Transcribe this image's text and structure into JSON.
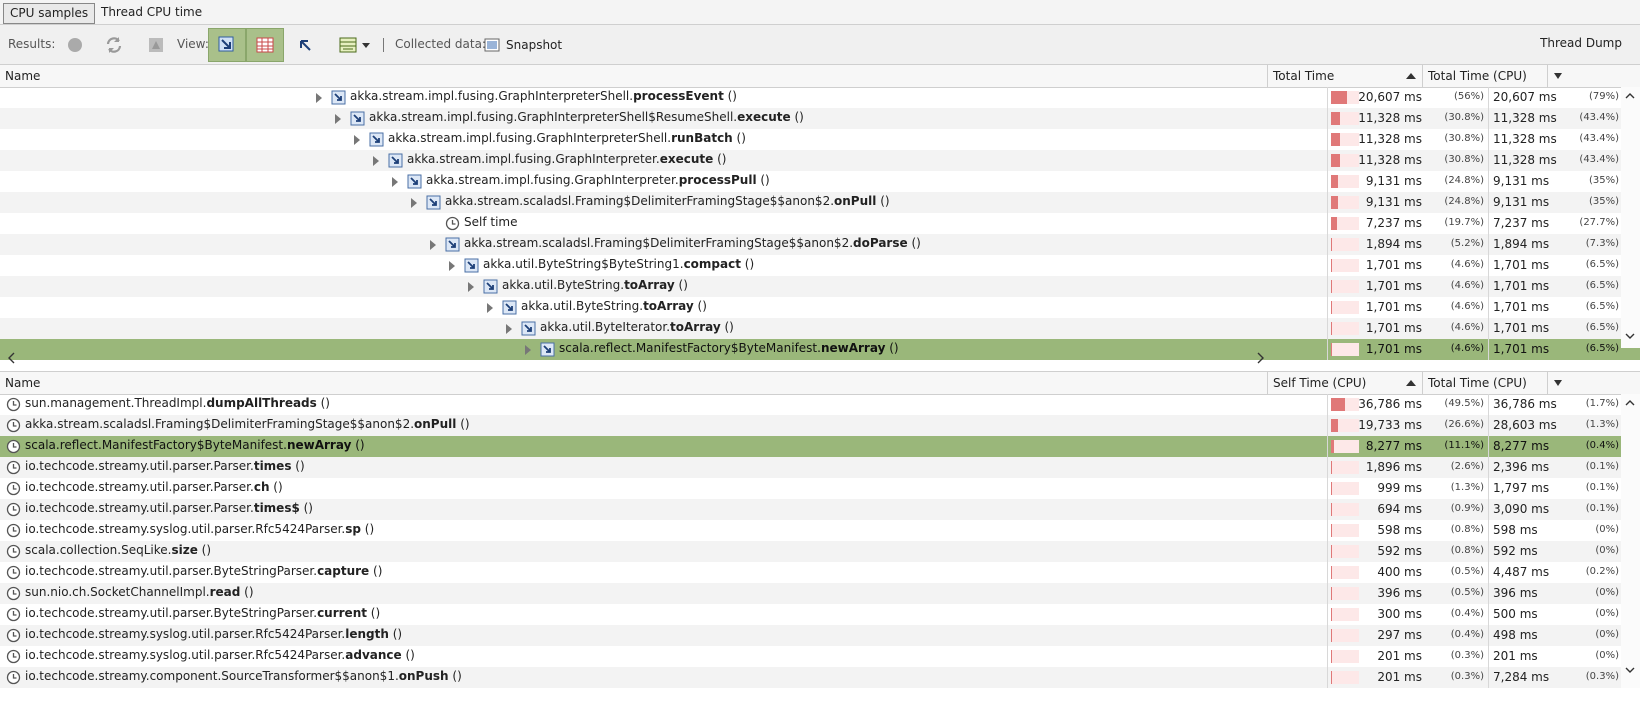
{
  "tabs": [
    {
      "label": "CPU samples",
      "active": true
    },
    {
      "label": "Thread CPU time",
      "active": false
    }
  ],
  "toolbar": {
    "results_label": "Results:",
    "view_label": "View:",
    "collected_label": "Collected data:",
    "snapshot_label": "Snapshot",
    "thread_dump_label": "Thread Dump"
  },
  "top_table": {
    "headers": {
      "name": "Name",
      "col1": "Total Time",
      "col2": "Total Time (CPU)"
    },
    "rows": [
      {
        "indent": 0,
        "icon": "method-icon",
        "prefix": "akka.stream.impl.fusing.GraphInterpreterShell.",
        "bold": "processEvent",
        "suffix": " ()",
        "v1": "20,607 ms",
        "p1": "(56%)",
        "f1": 0.56,
        "v2": "20,607 ms",
        "p2": "(79%)"
      },
      {
        "indent": 1,
        "icon": "method-icon",
        "prefix": "akka.stream.impl.fusing.GraphInterpreterShell$ResumeShell.",
        "bold": "execute",
        "suffix": " ()",
        "v1": "11,328 ms",
        "p1": "(30.8%)",
        "f1": 0.308,
        "v2": "11,328 ms",
        "p2": "(43.4%)"
      },
      {
        "indent": 2,
        "icon": "method-icon",
        "prefix": "akka.stream.impl.fusing.GraphInterpreterShell.",
        "bold": "runBatch",
        "suffix": " ()",
        "v1": "11,328 ms",
        "p1": "(30.8%)",
        "f1": 0.308,
        "v2": "11,328 ms",
        "p2": "(43.4%)"
      },
      {
        "indent": 3,
        "icon": "method-icon",
        "prefix": "akka.stream.impl.fusing.GraphInterpreter.",
        "bold": "execute",
        "suffix": " ()",
        "v1": "11,328 ms",
        "p1": "(30.8%)",
        "f1": 0.308,
        "v2": "11,328 ms",
        "p2": "(43.4%)"
      },
      {
        "indent": 4,
        "icon": "method-icon",
        "prefix": "akka.stream.impl.fusing.GraphInterpreter.",
        "bold": "processPull",
        "suffix": " ()",
        "v1": "9,131 ms",
        "p1": "(24.8%)",
        "f1": 0.248,
        "v2": "9,131 ms",
        "p2": "(35%)"
      },
      {
        "indent": 5,
        "icon": "method-icon",
        "prefix": "akka.stream.scaladsl.Framing$DelimiterFramingStage$$anon$2.",
        "bold": "onPull",
        "suffix": " ()",
        "v1": "9,131 ms",
        "p1": "(24.8%)",
        "f1": 0.248,
        "v2": "9,131 ms",
        "p2": "(35%)"
      },
      {
        "indent": 6,
        "icon": "clock-icon",
        "prefix": "Self time",
        "bold": "",
        "suffix": "",
        "leaf": true,
        "v1": "7,237 ms",
        "p1": "(19.7%)",
        "f1": 0.197,
        "v2": "7,237 ms",
        "p2": "(27.7%)"
      },
      {
        "indent": 6,
        "icon": "method-icon",
        "prefix": "akka.stream.scaladsl.Framing$DelimiterFramingStage$$anon$2.",
        "bold": "doParse",
        "suffix": " ()",
        "v1": "1,894 ms",
        "p1": "(5.2%)",
        "f1": 0.052,
        "v2": "1,894 ms",
        "p2": "(7.3%)"
      },
      {
        "indent": 7,
        "icon": "method-icon",
        "prefix": "akka.util.ByteString$ByteString1.",
        "bold": "compact",
        "suffix": " ()",
        "v1": "1,701 ms",
        "p1": "(4.6%)",
        "f1": 0.046,
        "v2": "1,701 ms",
        "p2": "(6.5%)"
      },
      {
        "indent": 8,
        "icon": "method-icon",
        "prefix": "akka.util.ByteString.",
        "bold": "toArray",
        "suffix": " ()",
        "v1": "1,701 ms",
        "p1": "(4.6%)",
        "f1": 0.046,
        "v2": "1,701 ms",
        "p2": "(6.5%)"
      },
      {
        "indent": 9,
        "icon": "method-icon",
        "prefix": "akka.util.ByteString.",
        "bold": "toArray",
        "suffix": " ()",
        "v1": "1,701 ms",
        "p1": "(4.6%)",
        "f1": 0.046,
        "v2": "1,701 ms",
        "p2": "(6.5%)"
      },
      {
        "indent": 10,
        "icon": "method-icon",
        "prefix": "akka.util.ByteIterator.",
        "bold": "toArray",
        "suffix": " ()",
        "v1": "1,701 ms",
        "p1": "(4.6%)",
        "f1": 0.046,
        "v2": "1,701 ms",
        "p2": "(6.5%)"
      },
      {
        "indent": 11,
        "icon": "method-icon",
        "prefix": "scala.reflect.ManifestFactory$ByteManifest.",
        "bold": "newArray",
        "suffix": " ()",
        "selected": true,
        "v1": "1,701 ms",
        "p1": "(4.6%)",
        "f1": 0.046,
        "v2": "1,701 ms",
        "p2": "(6.5%)"
      }
    ]
  },
  "bottom_table": {
    "headers": {
      "name": "Name",
      "col1": "Self Time (CPU)",
      "col2": "Total Time (CPU)"
    },
    "rows": [
      {
        "prefix": "sun.management.ThreadImpl.",
        "bold": "dumpAllThreads",
        "suffix": " ()",
        "v1": "36,786 ms",
        "p1": "(49.5%)",
        "f1": 0.495,
        "v2": "36,786 ms",
        "p2": "(1.7%)"
      },
      {
        "prefix": "akka.stream.scaladsl.Framing$DelimiterFramingStage$$anon$2.",
        "bold": "onPull",
        "suffix": " ()",
        "v1": "19,733 ms",
        "p1": "(26.6%)",
        "f1": 0.266,
        "v2": "28,603 ms",
        "p2": "(1.3%)"
      },
      {
        "prefix": "scala.reflect.ManifestFactory$ByteManifest.",
        "bold": "newArray",
        "suffix": " ()",
        "selected": true,
        "v1": "8,277 ms",
        "p1": "(11.1%)",
        "f1": 0.111,
        "v2": "8,277 ms",
        "p2": "(0.4%)"
      },
      {
        "prefix": "io.techcode.streamy.util.parser.Parser.",
        "bold": "times",
        "suffix": " ()",
        "v1": "1,896 ms",
        "p1": "(2.6%)",
        "f1": 0.026,
        "v2": "2,396 ms",
        "p2": "(0.1%)"
      },
      {
        "prefix": "io.techcode.streamy.util.parser.Parser.",
        "bold": "ch",
        "suffix": " ()",
        "v1": "999 ms",
        "p1": "(1.3%)",
        "f1": 0.013,
        "v2": "1,797 ms",
        "p2": "(0.1%)"
      },
      {
        "prefix": "io.techcode.streamy.util.parser.Parser.",
        "bold": "times$",
        "suffix": " ()",
        "v1": "694 ms",
        "p1": "(0.9%)",
        "f1": 0.009,
        "v2": "3,090 ms",
        "p2": "(0.1%)"
      },
      {
        "prefix": "io.techcode.streamy.syslog.util.parser.Rfc5424Parser.",
        "bold": "sp",
        "suffix": " ()",
        "v1": "598 ms",
        "p1": "(0.8%)",
        "f1": 0.008,
        "v2": "598 ms",
        "p2": "(0%)"
      },
      {
        "prefix": "scala.collection.SeqLike.",
        "bold": "size",
        "suffix": " ()",
        "v1": "592 ms",
        "p1": "(0.8%)",
        "f1": 0.008,
        "v2": "592 ms",
        "p2": "(0%)"
      },
      {
        "prefix": "io.techcode.streamy.util.parser.ByteStringParser.",
        "bold": "capture",
        "suffix": " ()",
        "v1": "400 ms",
        "p1": "(0.5%)",
        "f1": 0.005,
        "v2": "4,487 ms",
        "p2": "(0.2%)"
      },
      {
        "prefix": "sun.nio.ch.SocketChannelImpl.",
        "bold": "read",
        "suffix": " ()",
        "v1": "396 ms",
        "p1": "(0.5%)",
        "f1": 0.005,
        "v2": "396 ms",
        "p2": "(0%)"
      },
      {
        "prefix": "io.techcode.streamy.util.parser.ByteStringParser.",
        "bold": "current",
        "suffix": " ()",
        "v1": "300 ms",
        "p1": "(0.4%)",
        "f1": 0.004,
        "v2": "500 ms",
        "p2": "(0%)"
      },
      {
        "prefix": "io.techcode.streamy.syslog.util.parser.Rfc5424Parser.",
        "bold": "length",
        "suffix": " ()",
        "v1": "297 ms",
        "p1": "(0.4%)",
        "f1": 0.004,
        "v2": "498 ms",
        "p2": "(0%)"
      },
      {
        "prefix": "io.techcode.streamy.syslog.util.parser.Rfc5424Parser.",
        "bold": "advance",
        "suffix": " ()",
        "v1": "201 ms",
        "p1": "(0.3%)",
        "f1": 0.003,
        "v2": "201 ms",
        "p2": "(0%)"
      },
      {
        "prefix": "io.techcode.streamy.component.SourceTransformer$$anon$1.",
        "bold": "onPush",
        "suffix": " ()",
        "v1": "201 ms",
        "p1": "(0.3%)",
        "f1": 0.003,
        "v2": "7,284 ms",
        "p2": "(0.3%)"
      }
    ]
  },
  "colors": {
    "selection": "#9ab77a",
    "bar": "#e07878",
    "bar_bg": "#fde8e8"
  }
}
